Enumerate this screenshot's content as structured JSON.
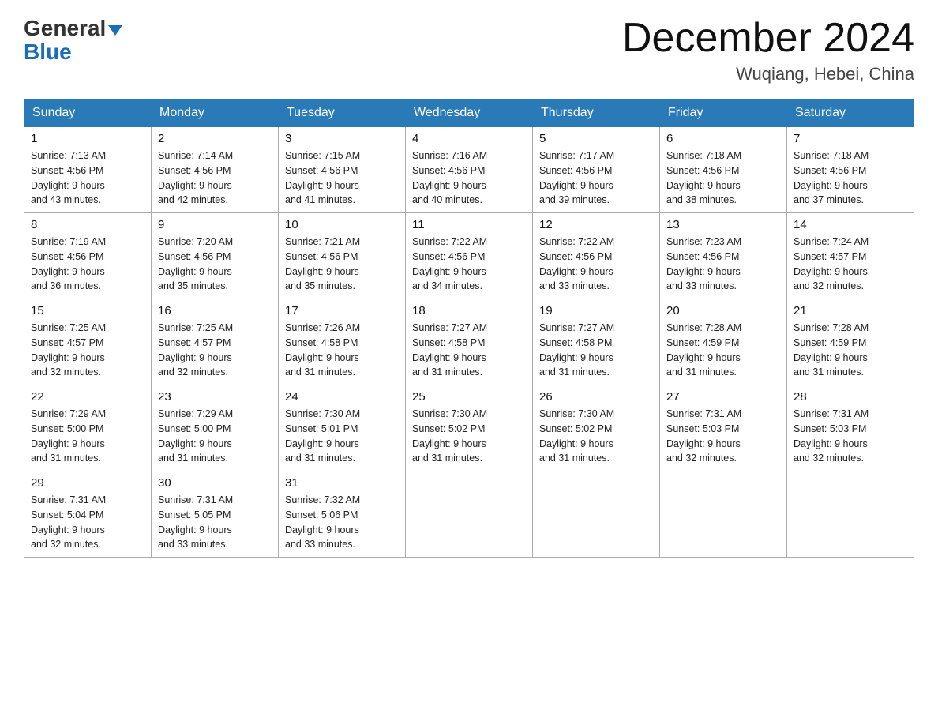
{
  "header": {
    "logo_general": "General",
    "logo_blue": "Blue",
    "month_title": "December 2024",
    "location": "Wuqiang, Hebei, China"
  },
  "days_of_week": [
    "Sunday",
    "Monday",
    "Tuesday",
    "Wednesday",
    "Thursday",
    "Friday",
    "Saturday"
  ],
  "weeks": [
    [
      {
        "day": "1",
        "sunrise": "7:13 AM",
        "sunset": "4:56 PM",
        "daylight": "9 hours and 43 minutes."
      },
      {
        "day": "2",
        "sunrise": "7:14 AM",
        "sunset": "4:56 PM",
        "daylight": "9 hours and 42 minutes."
      },
      {
        "day": "3",
        "sunrise": "7:15 AM",
        "sunset": "4:56 PM",
        "daylight": "9 hours and 41 minutes."
      },
      {
        "day": "4",
        "sunrise": "7:16 AM",
        "sunset": "4:56 PM",
        "daylight": "9 hours and 40 minutes."
      },
      {
        "day": "5",
        "sunrise": "7:17 AM",
        "sunset": "4:56 PM",
        "daylight": "9 hours and 39 minutes."
      },
      {
        "day": "6",
        "sunrise": "7:18 AM",
        "sunset": "4:56 PM",
        "daylight": "9 hours and 38 minutes."
      },
      {
        "day": "7",
        "sunrise": "7:18 AM",
        "sunset": "4:56 PM",
        "daylight": "9 hours and 37 minutes."
      }
    ],
    [
      {
        "day": "8",
        "sunrise": "7:19 AM",
        "sunset": "4:56 PM",
        "daylight": "9 hours and 36 minutes."
      },
      {
        "day": "9",
        "sunrise": "7:20 AM",
        "sunset": "4:56 PM",
        "daylight": "9 hours and 35 minutes."
      },
      {
        "day": "10",
        "sunrise": "7:21 AM",
        "sunset": "4:56 PM",
        "daylight": "9 hours and 35 minutes."
      },
      {
        "day": "11",
        "sunrise": "7:22 AM",
        "sunset": "4:56 PM",
        "daylight": "9 hours and 34 minutes."
      },
      {
        "day": "12",
        "sunrise": "7:22 AM",
        "sunset": "4:56 PM",
        "daylight": "9 hours and 33 minutes."
      },
      {
        "day": "13",
        "sunrise": "7:23 AM",
        "sunset": "4:56 PM",
        "daylight": "9 hours and 33 minutes."
      },
      {
        "day": "14",
        "sunrise": "7:24 AM",
        "sunset": "4:57 PM",
        "daylight": "9 hours and 32 minutes."
      }
    ],
    [
      {
        "day": "15",
        "sunrise": "7:25 AM",
        "sunset": "4:57 PM",
        "daylight": "9 hours and 32 minutes."
      },
      {
        "day": "16",
        "sunrise": "7:25 AM",
        "sunset": "4:57 PM",
        "daylight": "9 hours and 32 minutes."
      },
      {
        "day": "17",
        "sunrise": "7:26 AM",
        "sunset": "4:58 PM",
        "daylight": "9 hours and 31 minutes."
      },
      {
        "day": "18",
        "sunrise": "7:27 AM",
        "sunset": "4:58 PM",
        "daylight": "9 hours and 31 minutes."
      },
      {
        "day": "19",
        "sunrise": "7:27 AM",
        "sunset": "4:58 PM",
        "daylight": "9 hours and 31 minutes."
      },
      {
        "day": "20",
        "sunrise": "7:28 AM",
        "sunset": "4:59 PM",
        "daylight": "9 hours and 31 minutes."
      },
      {
        "day": "21",
        "sunrise": "7:28 AM",
        "sunset": "4:59 PM",
        "daylight": "9 hours and 31 minutes."
      }
    ],
    [
      {
        "day": "22",
        "sunrise": "7:29 AM",
        "sunset": "5:00 PM",
        "daylight": "9 hours and 31 minutes."
      },
      {
        "day": "23",
        "sunrise": "7:29 AM",
        "sunset": "5:00 PM",
        "daylight": "9 hours and 31 minutes."
      },
      {
        "day": "24",
        "sunrise": "7:30 AM",
        "sunset": "5:01 PM",
        "daylight": "9 hours and 31 minutes."
      },
      {
        "day": "25",
        "sunrise": "7:30 AM",
        "sunset": "5:02 PM",
        "daylight": "9 hours and 31 minutes."
      },
      {
        "day": "26",
        "sunrise": "7:30 AM",
        "sunset": "5:02 PM",
        "daylight": "9 hours and 31 minutes."
      },
      {
        "day": "27",
        "sunrise": "7:31 AM",
        "sunset": "5:03 PM",
        "daylight": "9 hours and 32 minutes."
      },
      {
        "day": "28",
        "sunrise": "7:31 AM",
        "sunset": "5:03 PM",
        "daylight": "9 hours and 32 minutes."
      }
    ],
    [
      {
        "day": "29",
        "sunrise": "7:31 AM",
        "sunset": "5:04 PM",
        "daylight": "9 hours and 32 minutes."
      },
      {
        "day": "30",
        "sunrise": "7:31 AM",
        "sunset": "5:05 PM",
        "daylight": "9 hours and 33 minutes."
      },
      {
        "day": "31",
        "sunrise": "7:32 AM",
        "sunset": "5:06 PM",
        "daylight": "9 hours and 33 minutes."
      },
      null,
      null,
      null,
      null
    ]
  ],
  "labels": {
    "sunrise": "Sunrise: ",
    "sunset": "Sunset: ",
    "daylight": "Daylight: "
  }
}
